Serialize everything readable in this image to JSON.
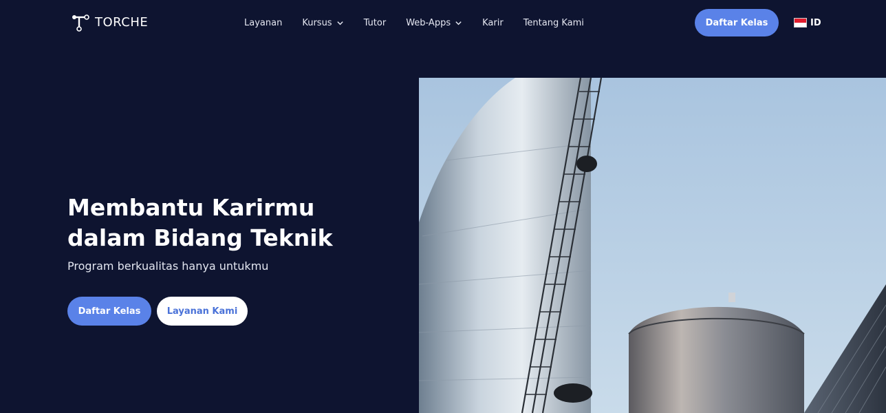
{
  "brand": {
    "name": "TORCHE",
    "logo_icon": "torche-logo-icon"
  },
  "nav": {
    "items": [
      {
        "label": "Layanan",
        "has_dropdown": false
      },
      {
        "label": "Kursus",
        "has_dropdown": true
      },
      {
        "label": "Tutor",
        "has_dropdown": false
      },
      {
        "label": "Web-Apps",
        "has_dropdown": true
      },
      {
        "label": "Karir",
        "has_dropdown": false
      },
      {
        "label": "Tentang Kami",
        "has_dropdown": false
      }
    ],
    "cta_label": "Daftar Kelas",
    "language": {
      "code": "ID",
      "flag_icon": "indonesia-flag-icon"
    }
  },
  "hero": {
    "title_line1": "Membantu Karirmu",
    "title_line2": "dalam Bidang Teknik",
    "subtitle": "Program berkualitas hanya untukmu",
    "primary_button": "Daftar Kelas",
    "secondary_button": "Layanan Kami",
    "image_icon": "industrial-tanks-photo"
  },
  "colors": {
    "background": "#0e1430",
    "accent": "#5a82e8",
    "secondary_button_text": "#4a72d8"
  }
}
